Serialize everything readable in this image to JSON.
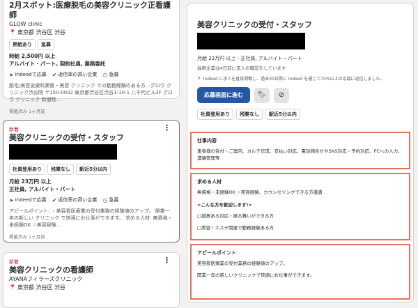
{
  "card1": {
    "title": "2月スボット:医療脱毛の美容クリニック正看護師",
    "company": "GLOW clinic",
    "location": "東京都 渋谷区 渋谷",
    "tags": [
      "昇給あり",
      "急募"
    ],
    "salary": "時給 2,500円 以上",
    "job_type": "アルバイト・パート, 契約社員, 業務委託",
    "meta": [
      "Indeedで応募",
      "返信率の高い企業",
      "急募"
    ],
    "desc": "脱毛/美容皮膚科業務・美容 クリニック での勤務経験のある方…グロウ クリニック渋谷院 〒150-0002 東京都渋谷区渋谷1-10-1 八千代ビル3F グロウ クリニック 新宿院…",
    "posted": "掲載済み 1ヶ月前"
  },
  "card2": {
    "badge": "新着",
    "title": "美容クリニックの受付・スタッフ",
    "tags": [
      "社員登用あり",
      "残業なし",
      "駅近5分以内"
    ],
    "salary": "月給 23万円 以上",
    "job_type": "正社員, アルバイト・パート",
    "meta": [
      "Indeedで応募",
      "返信率の高い企業",
      "急募"
    ],
    "desc": "アピールポイント: ・美容看医療業の受付業務の経験値のアップ。 開業一年の新しい クリニック で快適にお仕事ができます。 求める人材: 無資格・未経験OK ☆美容経験…",
    "posted": "掲載済み 1ヶ月前"
  },
  "card3": {
    "badge": "新着",
    "title": "美容クリニックの看護師",
    "company": "AYANAフィラーズクリニック",
    "location": "東京都 渋谷区 渋谷"
  },
  "detail": {
    "title": "美容クリニックの受付・スタッフ",
    "meta": "月給 23万円 以上 - 正社員, アルバイト・パート",
    "sub": "採用企業は4日前に求人の確認をしています",
    "sub2": "Indeed に求人を直接掲載し、過去30日間に Indeed を通じて75%以上の応募に返信しました。",
    "apply_label": "応募画面に進む",
    "tags": [
      "社員登用あり",
      "残業なし",
      "駅近5分以内"
    ]
  },
  "sections": {
    "work_title": "仕事内容",
    "work_text": "患者様の受付・ご案内、カルテ作成、支払い対応、電話問合せやSNS対応・予約対応、PCへの入力、濃類管理等",
    "req_title": "求める人材",
    "req_text": "無資格・未経験OK ☆美容経験、カウンセリングできる方優遇",
    "req_welcome": "<こんな方を歓迎します!>",
    "req_item1": "□誠意ある対応・振る舞いができる方",
    "req_item2": "□美容・エステ関連で勤務経験ある方",
    "appeal_title": "アピールポイント",
    "appeal_text1": "美容看医療業の受付業務の経験値のアップ。",
    "appeal_text2": "開業一年の新しいクリニックで快適にお仕事ができます。"
  }
}
